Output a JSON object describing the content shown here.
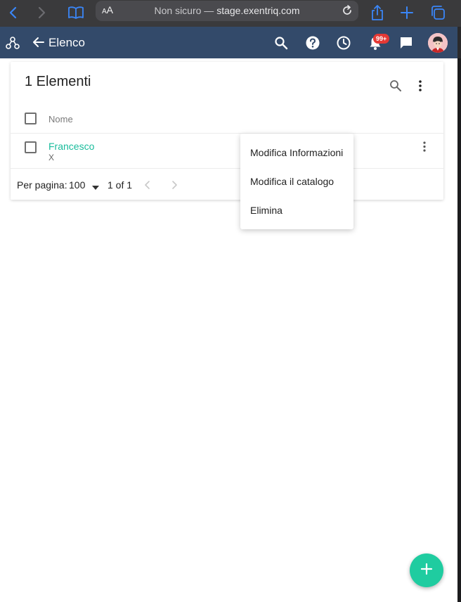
{
  "browser": {
    "aa_label_small": "A",
    "aa_label": "A",
    "url_prefix": "Non sicuro — ",
    "url_host": "stage.exentriq.com"
  },
  "header": {
    "title": "Elenco",
    "notification_badge": "99+"
  },
  "list": {
    "title": "1 Elementi",
    "column_header": "Nome",
    "rows": [
      {
        "name": "Francesco",
        "subtitle": "X"
      }
    ],
    "pagination": {
      "per_page_label": "Per pagina:",
      "per_page_value": "100",
      "range": "1 of 1"
    }
  },
  "row_menu": {
    "items": [
      "Modifica Informazioni",
      "Modifica il catalogo",
      "Elimina"
    ]
  },
  "colors": {
    "header_bg": "#334a6a",
    "accent": "#1abc9c",
    "fab": "#1fcca0",
    "badge": "#e53935"
  },
  "icons": {
    "browser": [
      "back-icon",
      "forward-icon",
      "reader-book-icon",
      "reload-icon",
      "share-icon",
      "new-tab-plus-icon",
      "tabs-icon"
    ],
    "header": [
      "workflow-logo-icon",
      "arrow-back-icon",
      "search-icon",
      "help-icon",
      "history-clock-icon",
      "notifications-bell-icon",
      "chat-icon"
    ],
    "card": [
      "search-icon",
      "more-vert-icon"
    ],
    "fab": "add-icon"
  }
}
